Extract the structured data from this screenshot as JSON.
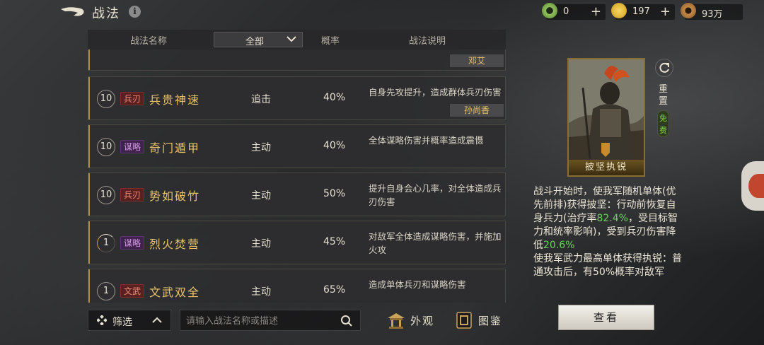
{
  "header": {
    "title": "战法",
    "info_icon": "info-icon"
  },
  "currencies": [
    {
      "icon": "jade-coin-icon",
      "value": "0",
      "color": "#8fbf5a"
    },
    {
      "icon": "gold-coin-icon",
      "value": "197",
      "color": "#e3b83a"
    },
    {
      "icon": "copper-coin-icon",
      "value": "93万",
      "color": "#c58a4a"
    }
  ],
  "table": {
    "columns": {
      "name": "战法名称",
      "filter": "全部",
      "rate": "概率",
      "desc": "战法说明"
    },
    "partial_row_owner": "邓艾",
    "rows": [
      {
        "level": "10",
        "tag": "兵刃",
        "tag_kind": "bing",
        "name": "兵贵神速",
        "type": "追击",
        "rate": "40%",
        "desc": "自身先攻提升，造成群体兵刃伤害",
        "owner": "孙尚香"
      },
      {
        "level": "10",
        "tag": "谋略",
        "tag_kind": "mou",
        "name": "奇门遁甲",
        "type": "主动",
        "rate": "40%",
        "desc": "全体谋略伤害并概率造成震慑",
        "owner": ""
      },
      {
        "level": "10",
        "tag": "兵刃",
        "tag_kind": "bing",
        "name": "势如破竹",
        "type": "主动",
        "rate": "50%",
        "desc": "提升自身会心几率，对全体造成兵刃伤害",
        "owner": ""
      },
      {
        "level": "1",
        "tag": "谋略",
        "tag_kind": "mou",
        "name": "烈火焚营",
        "type": "主动",
        "rate": "45%",
        "desc": "对敌军全体造成谋略伤害，并施加火攻",
        "owner": ""
      },
      {
        "level": "1",
        "tag": "文武",
        "tag_kind": "wenwu",
        "name": "文武双全",
        "type": "主动",
        "rate": "65%",
        "desc": "造成单体兵刃和谋略伤害",
        "owner": ""
      }
    ]
  },
  "bottom": {
    "filter_label": "筛选",
    "search_placeholder": "请输入战法名称或描述",
    "appearance_label": "外观",
    "codex_label": "图鉴"
  },
  "detail": {
    "card_name": "披坚执锐",
    "reset_label": "重置",
    "free_label": "免费",
    "line1_a": "战斗开始时，使我军随机单体(优先前排)获得披坚：行动前恢复自身兵力(治疗率",
    "heal_rate": "82.4%",
    "line1_b": "，受目标智力和统率影响)，受到兵刃伤害降低",
    "dmg_reduce": "20.6%",
    "line2": "使我军武力最高单体获得执锐：普通攻击后，有50%概率对敌军",
    "view_button": "查看"
  }
}
